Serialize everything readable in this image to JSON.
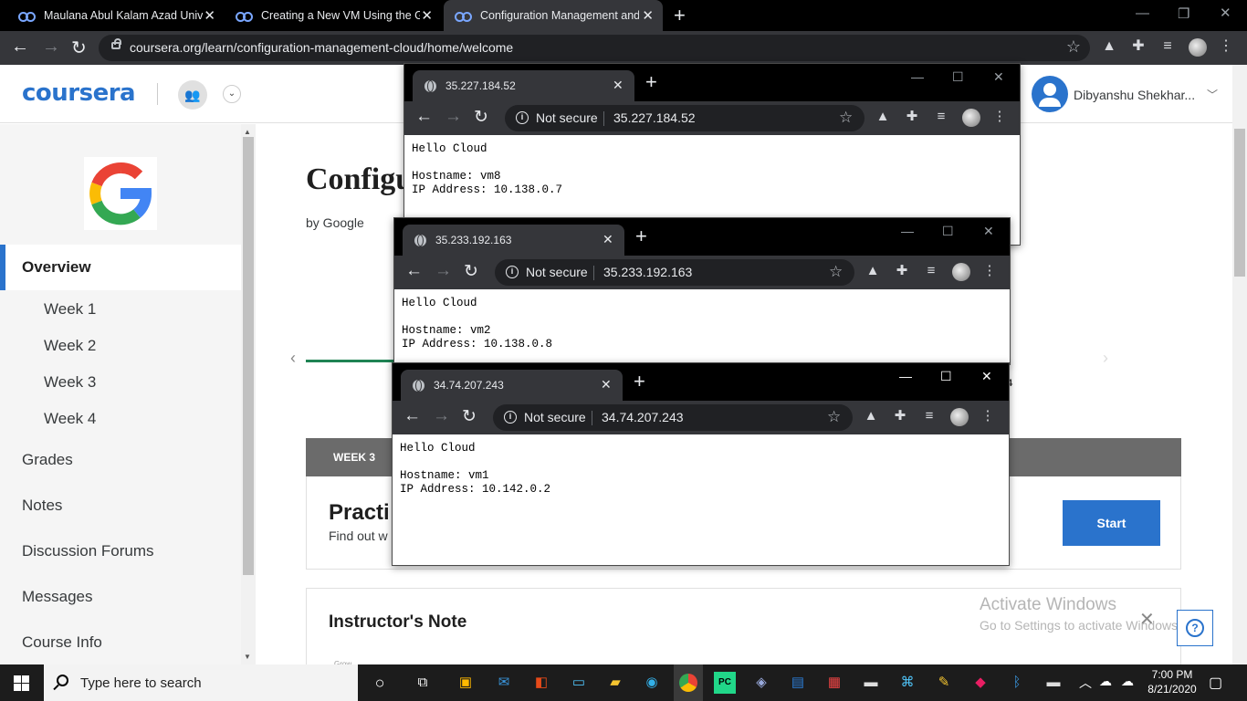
{
  "browser": {
    "tabs": [
      {
        "title": "Maulana Abul Kalam Azad Univer"
      },
      {
        "title": "Creating a New VM Using the GC"
      },
      {
        "title": "Configuration Management and"
      }
    ],
    "url": "coursera.org/learn/configuration-management-cloud/home/welcome"
  },
  "coursera": {
    "logo": "coursera",
    "user_name": "Dibyanshu Shekhar...",
    "course_title": "Configu",
    "byline": "by Google",
    "sidebar": {
      "overview": "Overview",
      "weeks": [
        "Week 1",
        "Week 2",
        "Week 3",
        "Week 4"
      ],
      "items": [
        "Grades",
        "Notes",
        "Discussion Forums",
        "Messages",
        "Course Info"
      ]
    },
    "peek_text": "4",
    "week_band": "WEEK 3",
    "practice_title": "Practi",
    "practice_desc": "Find out w",
    "start_button": "Start",
    "instructor_note": "Instructor's Note",
    "instructor_img_text": "Grow",
    "help_label": "?"
  },
  "watermark": {
    "line1": "Activate Windows",
    "line2": "Go to Settings to activate Windows."
  },
  "popups": [
    {
      "tab": "35.227.184.52",
      "not_secure": "Not secure",
      "ip_url": "35.227.184.52",
      "lines": [
        "Hello Cloud",
        "",
        "Hostname: vm8",
        "IP Address: 10.138.0.7"
      ]
    },
    {
      "tab": "35.233.192.163",
      "not_secure": "Not secure",
      "ip_url": "35.233.192.163",
      "lines": [
        "Hello Cloud",
        "",
        "Hostname: vm2",
        "IP Address: 10.138.0.8"
      ]
    },
    {
      "tab": "34.74.207.243",
      "not_secure": "Not secure",
      "ip_url": "34.74.207.243",
      "lines": [
        "Hello Cloud",
        "",
        "Hostname: vm1",
        "IP Address: 10.142.0.2"
      ]
    }
  ],
  "taskbar": {
    "search_placeholder": "Type here to search",
    "time": "7:00 PM",
    "date": "8/21/2020"
  },
  "colors": {
    "coursera_blue": "#2a73cc",
    "progress_green": "#1f8354",
    "chrome_dark": "#35363a"
  }
}
